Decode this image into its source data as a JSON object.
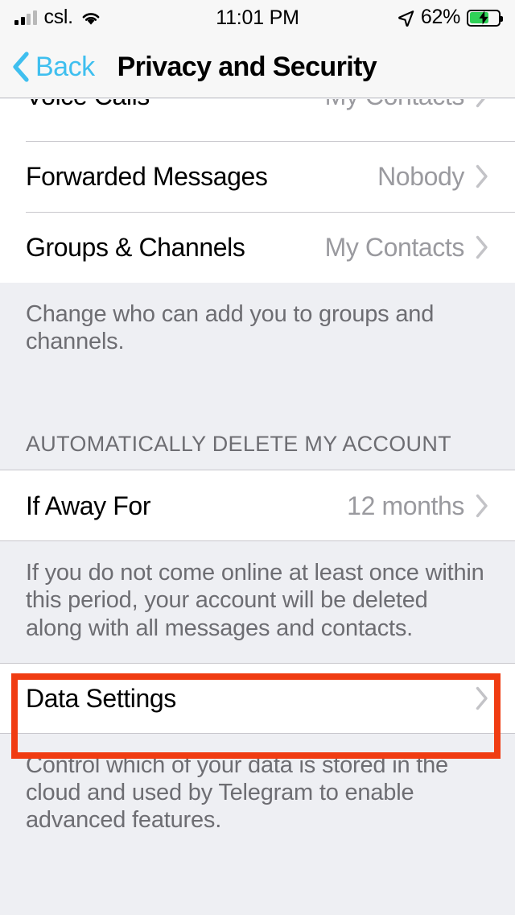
{
  "status_bar": {
    "carrier": "csl.",
    "time": "11:01 PM",
    "battery_percent": "62%",
    "battery_level": 62,
    "charging": true,
    "signal_bars_filled": 2,
    "signal_bars_total": 4,
    "wifi_icon": "wifi-icon",
    "location_icon": "location-arrow-icon",
    "battery_icon": "battery-charging-icon"
  },
  "nav": {
    "back_label": "Back",
    "back_icon": "chevron-left-icon",
    "title": "Privacy and Security",
    "tint_color": "#3fbfef"
  },
  "rows": {
    "voice_calls": {
      "label": "Voice Calls",
      "value": "My Contacts"
    },
    "forwarded_messages": {
      "label": "Forwarded Messages",
      "value": "Nobody"
    },
    "groups_channels": {
      "label": "Groups & Channels",
      "value": "My Contacts"
    },
    "if_away_for": {
      "label": "If Away For",
      "value": "12 months"
    },
    "data_settings": {
      "label": "Data Settings",
      "value": ""
    }
  },
  "notes": {
    "groups_note": "Change who can add you to groups and channels.",
    "away_note": "If you do not come online at least once within this period, your account will be deleted along with all messages and contacts.",
    "data_note": "Control which of your data is stored in the cloud and used by Telegram to enable advanced features."
  },
  "sections": {
    "auto_delete_header": "AUTOMATICALLY DELETE MY ACCOUNT"
  },
  "annotation": {
    "color": "#f03c12",
    "target": "data-settings-row"
  }
}
